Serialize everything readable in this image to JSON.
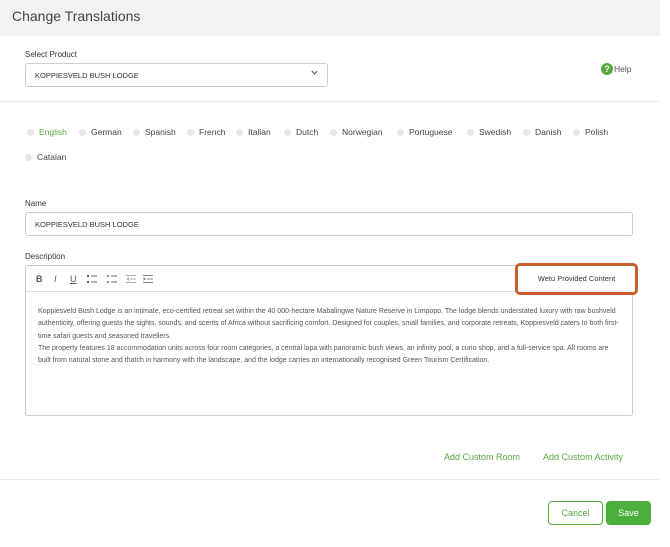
{
  "header": {
    "title": "Change Translations"
  },
  "product": {
    "label": "Select Product",
    "selected": "KOPPIESVELD BUSH LODGE"
  },
  "help": {
    "label": "Help",
    "icon": "?"
  },
  "languages": {
    "active": "English",
    "items": [
      "English",
      "German",
      "Spanish",
      "French",
      "Italian",
      "Dutch",
      "Norwegian",
      "Portuguese",
      "Swedish",
      "Danish",
      "Polish",
      "Catalan"
    ]
  },
  "name_field": {
    "label": "Name",
    "value": "KOPPIESVELD BUSH LODGE"
  },
  "description": {
    "label": "Description",
    "toolbar": {
      "bold": "B",
      "italic": "I",
      "underline": "U"
    },
    "wetu_badge": "Wetu Provided Content",
    "paragraphs": [
      "Koppiesveld Bush Lodge is an intimate, eco-certified retreat set within the 40 000-hectare Mabalingwe Nature Reserve in Limpopo. The lodge blends understated luxury with raw bushveld authenticity, offering guests the sights, sounds, and scents of Africa without sacrificing comfort. Designed for couples, small families, and corporate retreats, Koppiesveld caters to both first-time safari guests and seasoned travellers.",
      "The property features 18 accommodation units across four room categories, a central lapa with panoramic bush views, an infinity pool, a curio shop, and a full-service spa. All rooms are built from natural stone and thatch in harmony with the landscape, and the lodge carries an internationally recognised Green Tourism Certification."
    ]
  },
  "links": {
    "add_room": "Add Custom Room",
    "add_activity": "Add Custom Activity"
  },
  "footer": {
    "cancel": "Cancel",
    "save": "Save"
  },
  "colors": {
    "accent": "#57a93e",
    "highlight": "#c8602c"
  }
}
